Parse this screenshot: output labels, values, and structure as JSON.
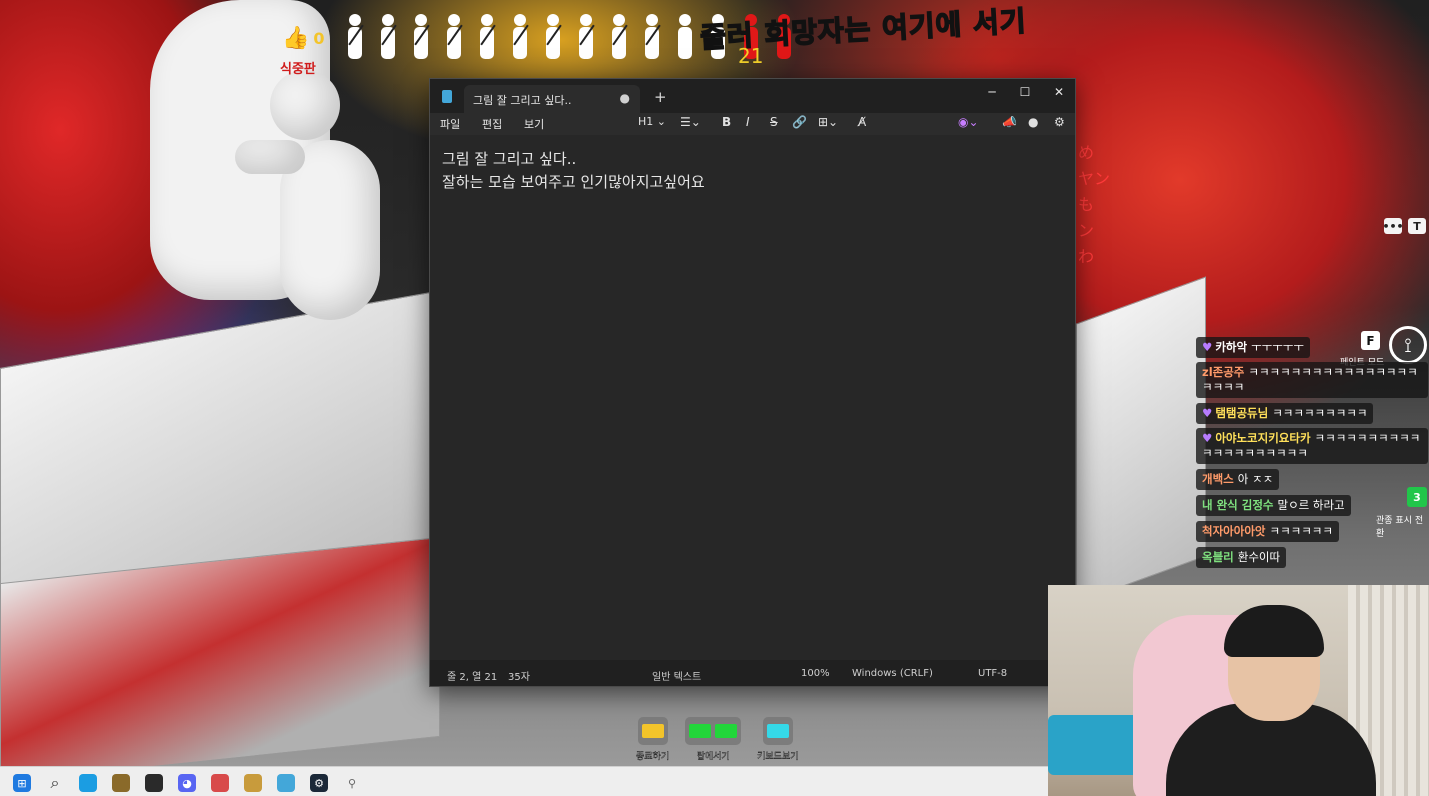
{
  "hud": {
    "thumb_icon": "thumbs-up-icon",
    "likes": "0",
    "caption": "식중판",
    "banner": "줄러 희망자는 여기에 서기",
    "counter": "21",
    "people_total": 14,
    "people_red": 2
  },
  "notepad": {
    "tab_title": "그림 잘 그리고 싶다..",
    "menu": {
      "file": "파일",
      "edit": "편집",
      "view": "보기"
    },
    "toolbar": {
      "heading": "H1",
      "bold": "B",
      "italic": "I",
      "strike": "S"
    },
    "content": {
      "line1": "그림 잘 그리고 싶다..",
      "line2": "잘하는 모습 보여주고 인기많아지고싶어요"
    },
    "status": {
      "position": "줄 2, 열 21",
      "chars": "35자",
      "format": "일반 텍스트",
      "zoom": "100%",
      "line_ending": "Windows (CRLF)",
      "encoding": "UTF-8"
    }
  },
  "overlay": {
    "chat_icon": "chat-bubble-icon",
    "text_icon": "T",
    "f_key": "F",
    "paint_mode_label": "페인트 모드",
    "view_badge": "3",
    "view_label": "관종 표시 전환"
  },
  "chat": [
    {
      "name": "카하악",
      "text": "ㅜㅜㅜㅜㅜ",
      "name_color": "#ffffff",
      "heart": true
    },
    {
      "name": "zl존공주",
      "text": "ㅋㅋㅋㅋㅋㅋㅋㅋㅋㅋㅋㅋㅋㅋㅋㅋㅋㅋㅋㅋ",
      "name_color": "#ff9b6a",
      "heart": false
    },
    {
      "name": "탬탬공듀님",
      "text": "ㅋㅋㅋㅋㅋㅋㅋㅋㅋ",
      "name_color": "#ffe05a",
      "heart": true
    },
    {
      "name": "아야노코지키요타카",
      "text": "ㅋㅋㅋㅋㅋㅋㅋㅋㅋㅋㅋㅋㅋㅋㅋㅋㅋㅋㅋㅋ",
      "name_color": "#ffe05a",
      "heart": true
    },
    {
      "name": "개백스",
      "text": "아 ㅈㅈ",
      "name_color": "#ff9b6a",
      "heart": false
    },
    {
      "name": "내 완식 김정수",
      "text": "말ㅇ르 하라고",
      "name_color": "#7fe07f",
      "heart": false
    },
    {
      "name": "척자아아아앗",
      "text": "ㅋㅋㅋㅋㅋㅋ",
      "name_color": "#ff9b6a",
      "heart": false
    },
    {
      "name": "옥블리",
      "text": "환수이따",
      "name_color": "#7fe07f",
      "heart": false
    }
  ],
  "game_buttons": [
    {
      "label": "종료하기",
      "chips": [
        "#f3c42a"
      ]
    },
    {
      "label": "탑에서기",
      "chips": [
        "#22d63a",
        "#22d63a"
      ]
    },
    {
      "label": "키보드보기",
      "chips": [
        "#35d9e8"
      ]
    }
  ],
  "taskbar": [
    {
      "name": "windows-start-icon",
      "color": "#1f7ae0"
    },
    {
      "name": "search-icon",
      "color": "#333333"
    },
    {
      "name": "edge-icon",
      "color": "#1b9de2"
    },
    {
      "name": "game-app-icon",
      "color": "#8a6a2a"
    },
    {
      "name": "obs-icon",
      "color": "#2a2a2a"
    },
    {
      "name": "discord-icon",
      "color": "#5865f2"
    },
    {
      "name": "streaming-app-icon",
      "color": "#d84a4a"
    },
    {
      "name": "league-icon",
      "color": "#c89b3c"
    },
    {
      "name": "notepad-icon",
      "color": "#43a7d9"
    },
    {
      "name": "steam-icon",
      "color": "#1b2838"
    },
    {
      "name": "tool-icon",
      "color": "#666666"
    }
  ]
}
